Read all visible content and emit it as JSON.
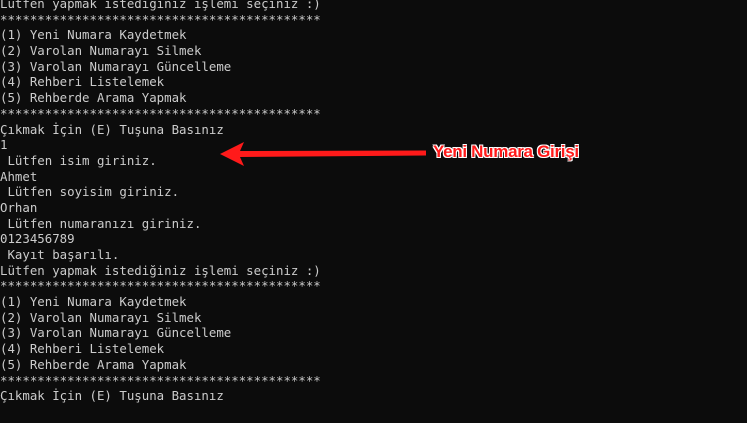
{
  "console": {
    "lines": [
      "Lütfen yapmak istediğiniz işlemi seçiniz :)",
      "*******************************************",
      "(1) Yeni Numara Kaydetmek",
      "(2) Varolan Numarayı Silmek",
      "(3) Varolan Numarayı Güncelleme",
      "(4) Rehberi Listelemek",
      "(5) Rehberde Arama Yapmak",
      "*******************************************",
      "Çıkmak İçin (E) Tuşuna Basınız",
      "1",
      " Lütfen isim giriniz.",
      "Ahmet",
      " Lütfen soyisim giriniz.",
      "Orhan",
      " Lütfen numaranızı giriniz.",
      "0123456789",
      " Kayıt başarılı.",
      "Lütfen yapmak istediğiniz işlemi seçiniz :)",
      "*******************************************",
      "(1) Yeni Numara Kaydetmek",
      "(2) Varolan Numarayı Silmek",
      "(3) Varolan Numarayı Güncelleme",
      "(4) Rehberi Listelemek",
      "(5) Rehberde Arama Yapmak",
      "*******************************************",
      "Çıkmak İçin (E) Tuşuna Basınız"
    ]
  },
  "annotation": {
    "label": "Yeni Numara Girişi",
    "color": "#ff1a1a",
    "icon": "arrow-left-icon"
  },
  "colors": {
    "background": "#0c0c0c",
    "text": "#cccccc"
  }
}
